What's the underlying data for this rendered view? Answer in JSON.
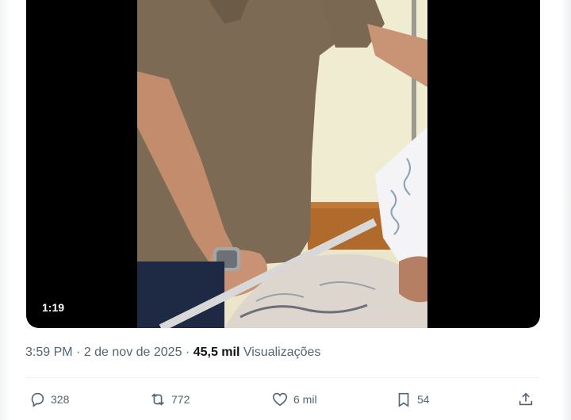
{
  "video": {
    "duration": "1:19"
  },
  "post_meta": {
    "time": "3:59 PM",
    "separator1": " · ",
    "date": "2 de nov de 2025",
    "separator2": " · ",
    "views_count": "45,5 mil",
    "views_label": " Visualizações"
  },
  "actions": {
    "replies": "328",
    "reposts": "772",
    "likes": "6 mil",
    "bookmarks": "54"
  },
  "icons": [
    "reply-icon",
    "repost-icon",
    "like-icon",
    "bookmark-icon",
    "share-icon"
  ]
}
